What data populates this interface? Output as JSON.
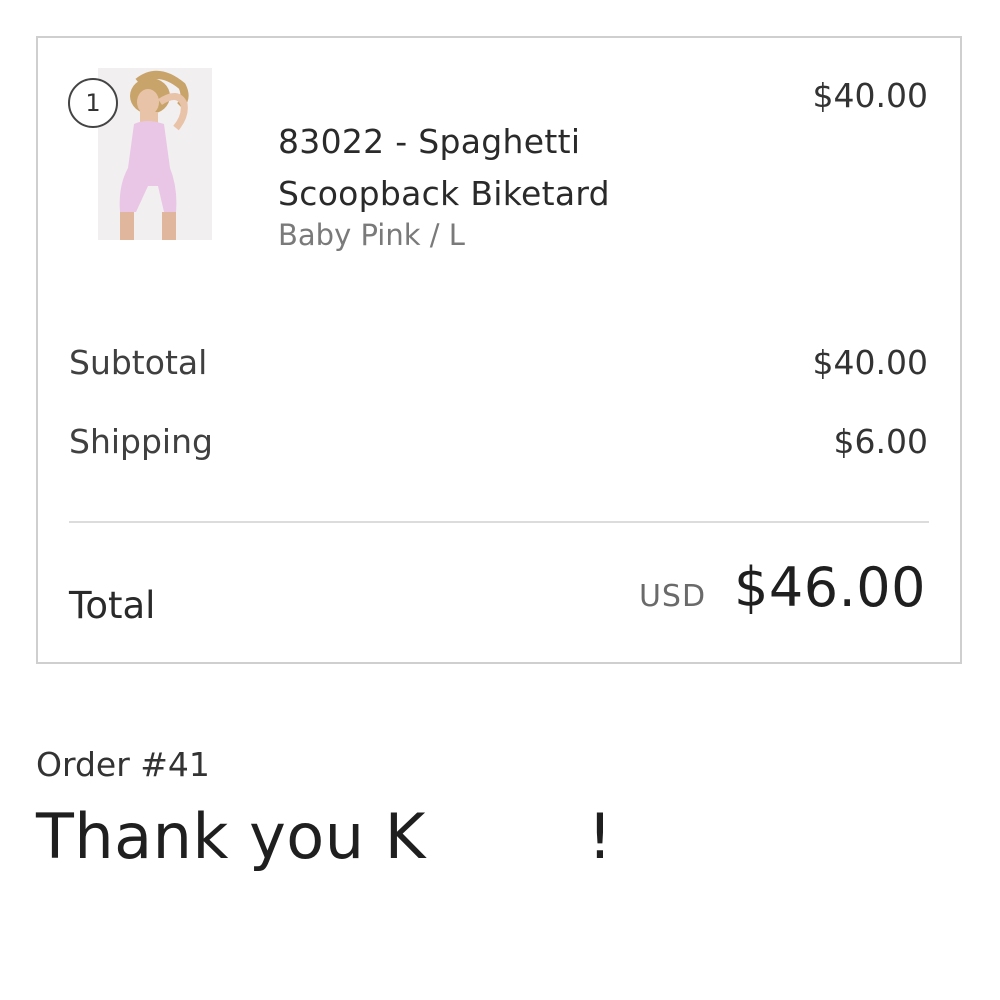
{
  "line_item": {
    "quantity": "1",
    "name": "83022 - Spaghetti Scoopback Biketard",
    "variant": "Baby Pink / L",
    "price": "$40.00",
    "image_icon": "product-photo-icon",
    "product_color": "#e9c6e6"
  },
  "summary": {
    "subtotal_label": "Subtotal",
    "subtotal_value": "$40.00",
    "shipping_label": "Shipping",
    "shipping_value": "$6.00",
    "total_label": "Total",
    "currency": "USD",
    "total_value": "$46.00"
  },
  "order": {
    "number": "Order #41",
    "thank_you": "Thank you K        !"
  }
}
